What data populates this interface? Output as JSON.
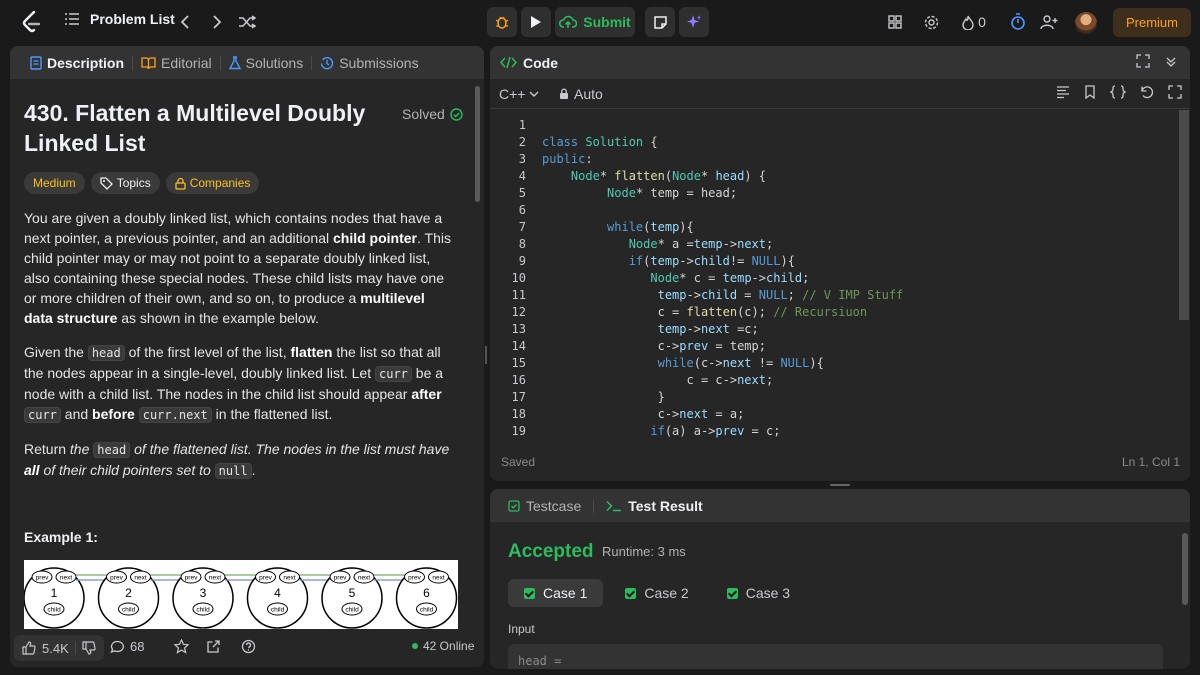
{
  "header": {
    "problem_list_label": "Problem List",
    "submit_label": "Submit",
    "streak_count": "0",
    "premium_label": "Premium"
  },
  "left_tabs": [
    "Description",
    "Editorial",
    "Solutions",
    "Submissions"
  ],
  "problem": {
    "title": "430. Flatten a Multilevel Doubly Linked List",
    "status": "Solved",
    "difficulty": "Medium",
    "topics_label": "Topics",
    "companies_label": "Companies",
    "p1": {
      "t1": "You are given a doubly linked list, which contains nodes that have a next pointer, a previous pointer, and an additional ",
      "b1": "child pointer",
      "t2": ". This child pointer may or may not point to a separate doubly linked list, also containing these special nodes. These child lists may have one or more children of their own, and so on, to produce a ",
      "b2": "multilevel data structure",
      "t3": " as shown in the example below."
    },
    "p2": {
      "t1": "Given the ",
      "c1": "head",
      "t2": " of the first level of the list, ",
      "b1": "flatten",
      "t3": " the list so that all the nodes appear in a single-level, doubly linked list. Let ",
      "c2": "curr",
      "t4": " be a node with a child list. The nodes in the child list should appear ",
      "b2": "after",
      "t5": " ",
      "c3": "curr",
      "t6": " and ",
      "b3": "before",
      "t7": " ",
      "c4": "curr.next",
      "t8": " in the flattened list."
    },
    "p3": {
      "t1": "Return ",
      "i1": "the ",
      "c1": "head",
      "i2": " of the flattened list. The nodes in the list must have ",
      "b1": "all",
      "i3": " of their child pointers set to ",
      "c2": "null",
      "t2": "."
    },
    "example_label": "Example 1:",
    "diagram": {
      "nodes": [
        "1",
        "2",
        "3",
        "4",
        "5",
        "6"
      ],
      "prev": "prev",
      "next": "next",
      "child": "child"
    }
  },
  "footer": {
    "likes": "5.4K",
    "comments": "68",
    "online": "42 Online"
  },
  "code_panel": {
    "title": "Code",
    "language": "C++",
    "mode": "Auto",
    "saved": "Saved",
    "cursor": "Ln 1, Col 1"
  },
  "code_lines": [
    "",
    "class Solution {",
    "public:",
    "    Node* flatten(Node* head) {",
    "         Node* temp = head;",
    "",
    "         while(temp){",
    "            Node* a =temp->next;",
    "            if(temp->child!= NULL){",
    "               Node* c = temp->child;",
    "                temp->child = NULL; // V IMP Stuff",
    "                c = flatten(c); // Recursiuon",
    "                temp->next =c;",
    "                c->prev = temp;",
    "                while(c->next != NULL){",
    "                    c = c->next;",
    "                }",
    "                c->next = a;",
    "               if(a) a->prev = c;"
  ],
  "test_panel": {
    "tabs": [
      "Testcase",
      "Test Result"
    ],
    "result": "Accepted",
    "runtime": "Runtime: 3 ms",
    "cases": [
      "Case 1",
      "Case 2",
      "Case 3"
    ],
    "input_label": "Input",
    "input_value": "head ="
  }
}
